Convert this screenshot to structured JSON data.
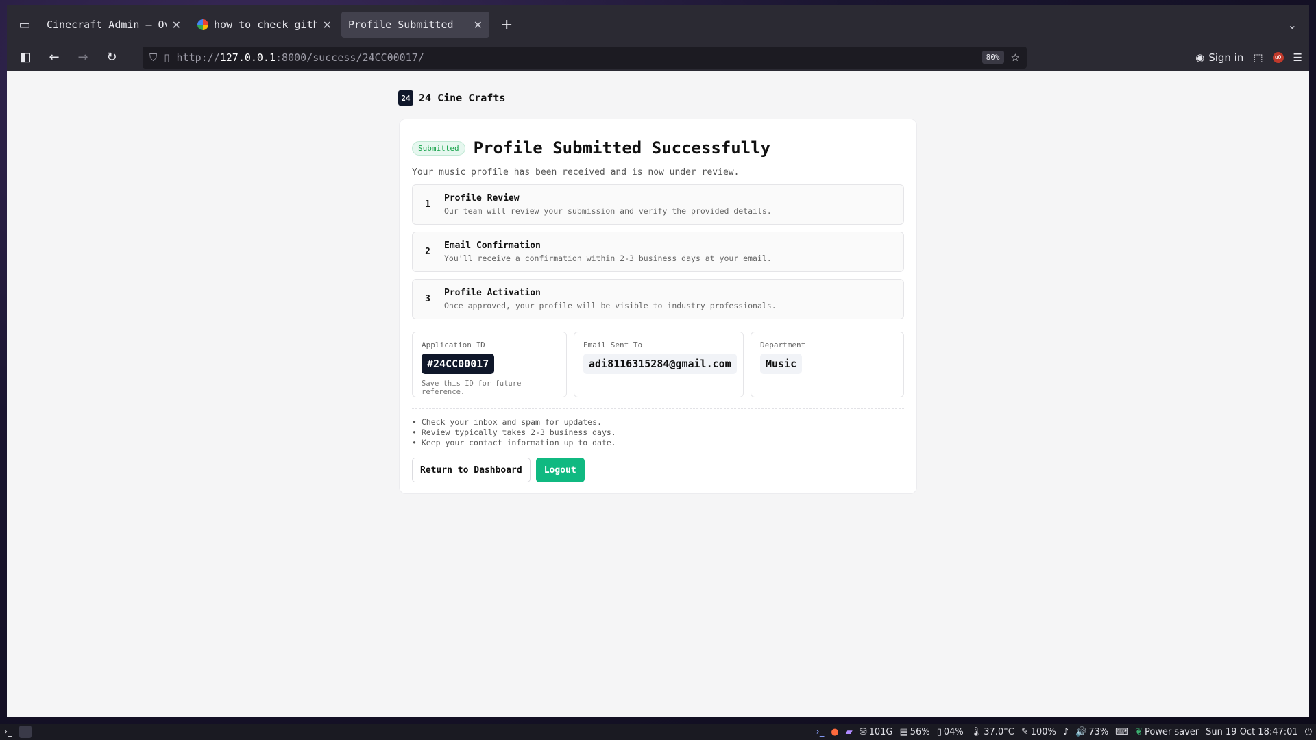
{
  "browser": {
    "tabs": [
      {
        "label": "Cinecraft Admin — Overvi",
        "active": false
      },
      {
        "label": "how to check github a",
        "active": false
      },
      {
        "label": "Profile Submitted",
        "active": true
      }
    ],
    "url_prefix": "http://",
    "url_host": "127.0.0.1",
    "url_rest": ":8000/success/24CC00017/",
    "zoom": "80%",
    "sign_in": "Sign in"
  },
  "brand": {
    "mark": "24",
    "name": "24 Cine Crafts"
  },
  "card": {
    "badge": "Submitted",
    "title": "Profile Submitted Successfully",
    "subtitle": "Your music profile has been received and is now under review.",
    "steps": [
      {
        "num": "1",
        "title": "Profile Review",
        "desc": "Our team will review your submission and verify the provided details."
      },
      {
        "num": "2",
        "title": "Email Confirmation",
        "desc": "You'll receive a confirmation within 2-3 business days at your email."
      },
      {
        "num": "3",
        "title": "Profile Activation",
        "desc": "Once approved, your profile will be visible to industry professionals."
      }
    ],
    "application": {
      "label": "Application ID",
      "value": "#24CC00017",
      "note": "Save this ID for future reference."
    },
    "email": {
      "label": "Email Sent To",
      "value": "adi8116315284@gmail.com"
    },
    "department": {
      "label": "Department",
      "value": "Music"
    },
    "tips": [
      "Check your inbox and spam for updates.",
      "Review typically takes 2-3 business days.",
      "Keep your contact information up to date."
    ],
    "buttons": {
      "dashboard": "Return to Dashboard",
      "logout": "Logout"
    }
  },
  "taskbar": {
    "disk": "101G",
    "memory": "56%",
    "cpu": "04%",
    "temp": "37.0°C",
    "brightness": "100%",
    "volume": "73%",
    "power": "Power saver",
    "datetime": "Sun 19 Oct 18:47:01"
  }
}
